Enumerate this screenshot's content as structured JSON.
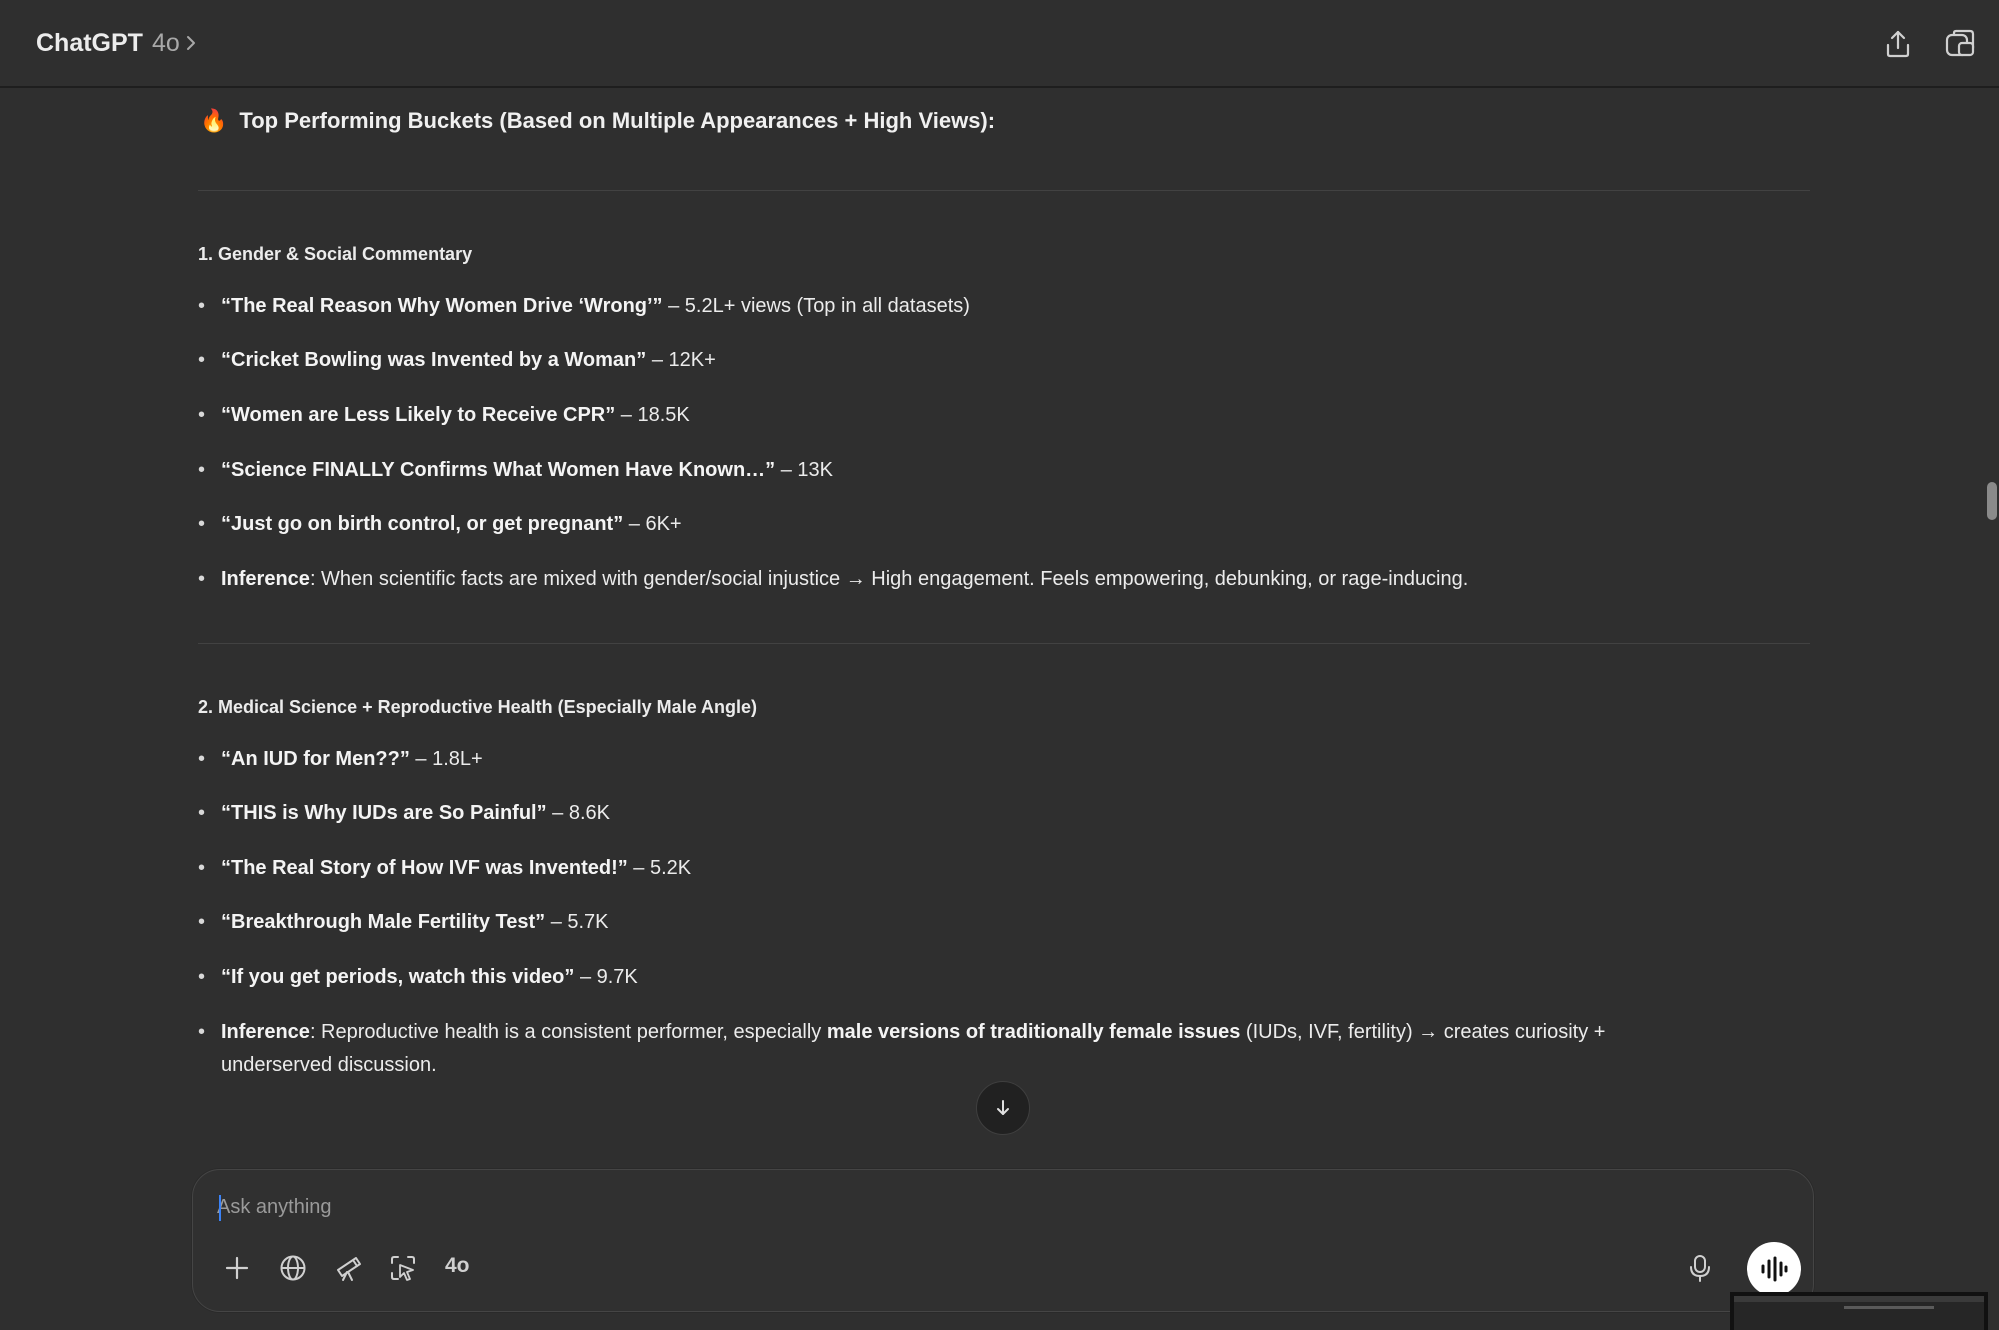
{
  "header": {
    "app_name": "ChatGPT",
    "model": "4o",
    "chevron_icon": "chevron-right-icon",
    "share_icon": "share-icon",
    "new_chat_icon": "new-chat-icon"
  },
  "message": {
    "heading_emoji": "🔥",
    "heading": "Top Performing Buckets (Based on Multiple Appearances + High Views):",
    "sections": [
      {
        "title": "1. Gender & Social Commentary",
        "items": [
          {
            "bold": "“The Real Reason Why Women Drive ‘Wrong’”",
            "rest": " – 5.2L+ views (Top in all datasets)"
          },
          {
            "bold": "“Cricket Bowling was Invented by a Woman”",
            "rest": " – 12K+"
          },
          {
            "bold": "“Women are Less Likely to Receive CPR”",
            "rest": " – 18.5K"
          },
          {
            "bold": "“Science FINALLY Confirms What Women Have Known…”",
            "rest": " – 13K"
          },
          {
            "bold": "“Just go on birth control, or get pregnant”",
            "rest": " – 6K+"
          },
          {
            "bold": "Inference",
            "rest": ": When scientific facts are mixed with gender/social injustice → High engagement. Feels empowering, debunking, or rage-inducing."
          }
        ]
      },
      {
        "title": "2. Medical Science + Reproductive Health (Especially Male Angle)",
        "items": [
          {
            "bold": "“An IUD for Men??”",
            "rest": " – 1.8L+"
          },
          {
            "bold": "“THIS is Why IUDs are So Painful”",
            "rest": " – 8.6K"
          },
          {
            "bold": "“The Real Story of How IVF was Invented!”",
            "rest": " – 5.2K"
          },
          {
            "bold": "“Breakthrough Male Fertility Test”",
            "rest": " – 5.7K"
          },
          {
            "bold": "“If you get periods, watch this video”",
            "rest": " – 9.7K"
          }
        ],
        "inference": {
          "label": "Inference",
          "part1": ": Reproductive health is a consistent performer, especially ",
          "bold": "male versions of traditionally female issues",
          "part2": " (IUDs, IVF, fertility) → creates curiosity + underserved discussion."
        }
      }
    ]
  },
  "scroll_button_icon": "arrow-down-icon",
  "composer": {
    "placeholder": "Ask anything",
    "value": "",
    "tools": [
      "plus-icon",
      "globe-icon",
      "telescope-icon",
      "cursor-select-icon"
    ],
    "model_label": "4o",
    "mic_icon": "microphone-icon",
    "voice_icon": "voice-mode-icon"
  }
}
